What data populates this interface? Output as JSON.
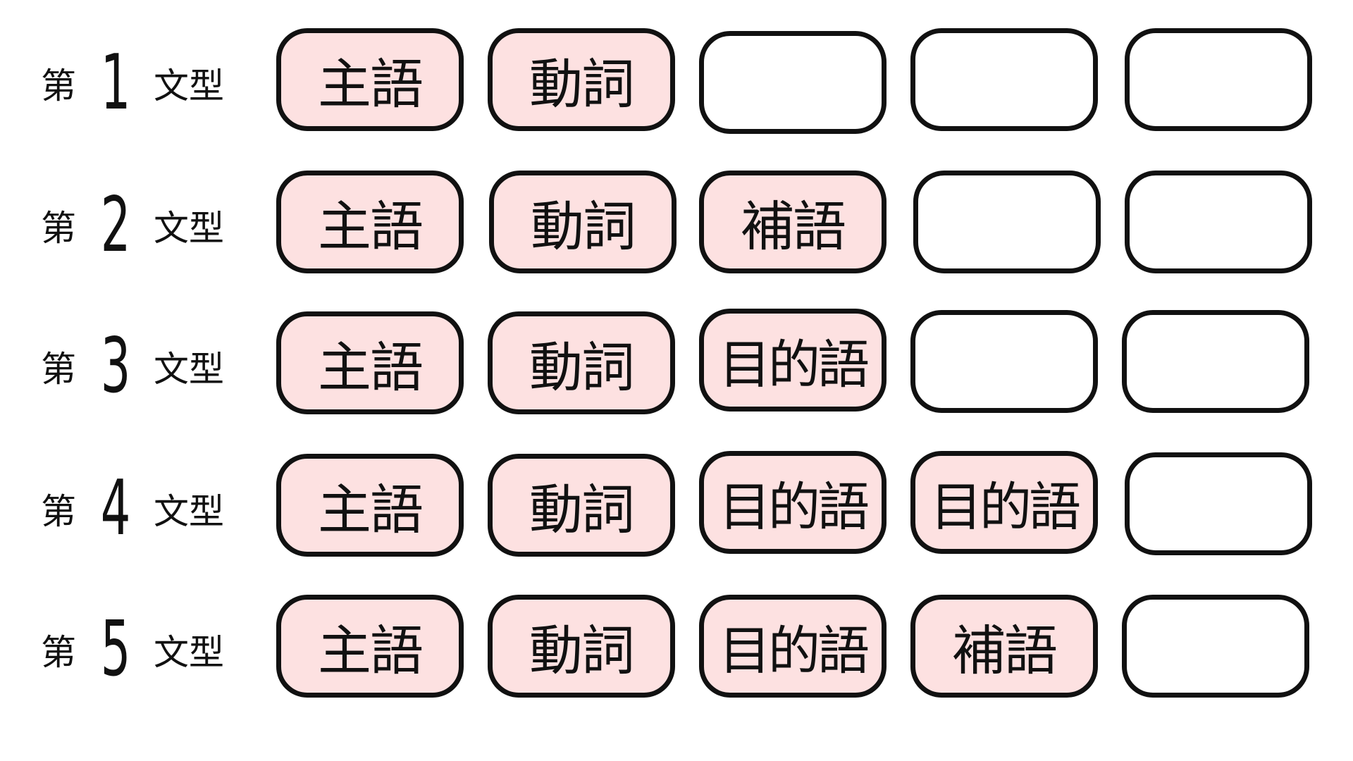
{
  "diagram": {
    "label_prefix": "第",
    "label_suffix": "文型",
    "fill_color": "#fde1e1",
    "border_color": "#111111",
    "rows": [
      {
        "number": "1",
        "slots": [
          "主語",
          "動詞",
          "",
          "",
          ""
        ]
      },
      {
        "number": "2",
        "slots": [
          "主語",
          "動詞",
          "補語",
          "",
          ""
        ]
      },
      {
        "number": "3",
        "slots": [
          "主語",
          "動詞",
          "目的語",
          "",
          ""
        ]
      },
      {
        "number": "4",
        "slots": [
          "主語",
          "動詞",
          "目的語",
          "目的語",
          ""
        ]
      },
      {
        "number": "5",
        "slots": [
          "主語",
          "動詞",
          "目的語",
          "補語",
          ""
        ]
      }
    ]
  }
}
